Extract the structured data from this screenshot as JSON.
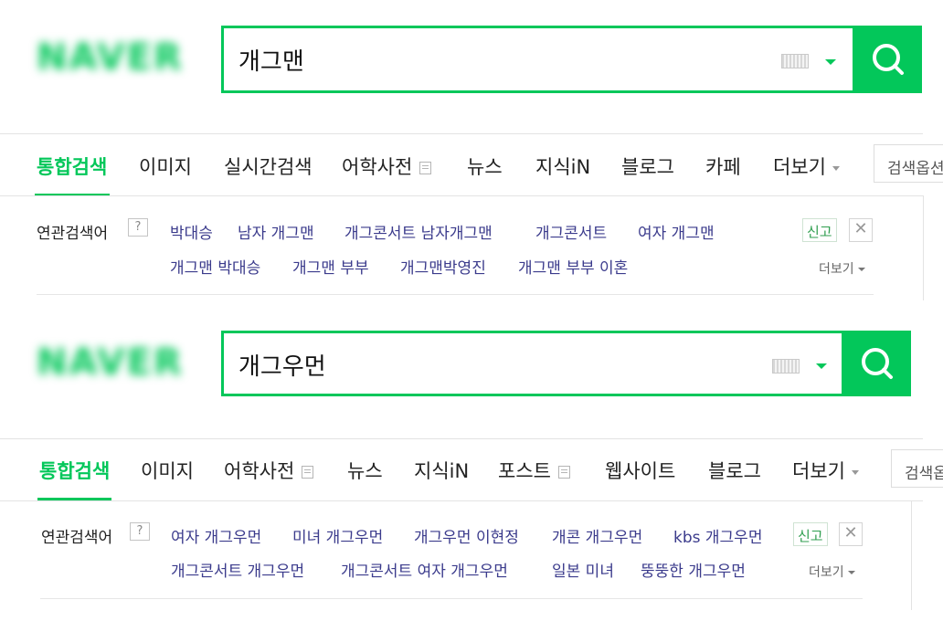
{
  "colors": {
    "brand": "#03c75a",
    "link": "#3b3b8c",
    "report": "#2f9e4f"
  },
  "panels": [
    {
      "logo": "NAVER",
      "query": "개그맨",
      "tabs": [
        "통합검색",
        "이미지",
        "실시간검색",
        "어학사전",
        "뉴스",
        "지식iN",
        "블로그",
        "카페",
        "더보기"
      ],
      "option_box": "검색옵션",
      "related_label": "연관검색어",
      "help": "?",
      "related_row1": [
        "박대승",
        "남자 개그맨",
        "개그콘서트 남자개그맨",
        "개그콘서트",
        "여자 개그맨"
      ],
      "related_row2": [
        "개그맨 박대승",
        "개그맨 부부",
        "개그맨박영진",
        "개그맨 부부 이혼"
      ],
      "report": "신고",
      "close": "✕",
      "more": "더보기"
    },
    {
      "logo": "NAVER",
      "query": "개그우먼",
      "tabs": [
        "통합검색",
        "이미지",
        "어학사전",
        "뉴스",
        "지식iN",
        "포스트",
        "웹사이트",
        "블로그",
        "더보기"
      ],
      "option_box": "검색옵",
      "related_label": "연관검색어",
      "help": "?",
      "related_row1": [
        "여자 개그우먼",
        "미녀 개그우먼",
        "개그우먼 이현정",
        "개콘 개그우먼",
        "kbs 개그우먼"
      ],
      "related_row2": [
        "개그콘서트 개그우먼",
        "개그콘서트 여자 개그우먼",
        "일본 미녀",
        "뚱뚱한 개그우먼"
      ],
      "report": "신고",
      "close": "✕",
      "more": "더보기"
    }
  ]
}
